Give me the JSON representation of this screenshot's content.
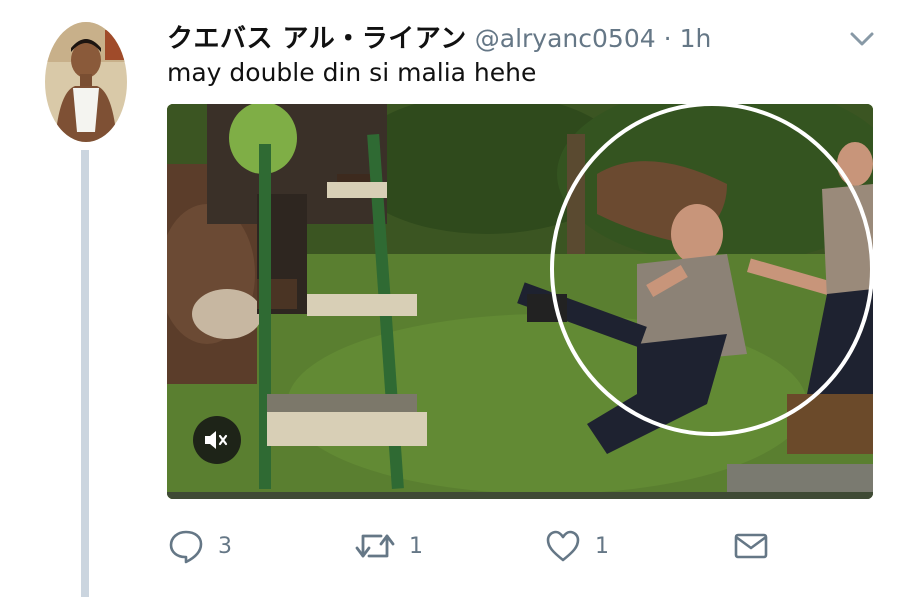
{
  "tweet": {
    "display_name": "クエバス アル・ライアン",
    "handle": "@alryanc0504",
    "separator": "·",
    "time": "1h",
    "text": "may double din si malia hehe"
  },
  "media": {
    "kind": "video",
    "muted": true,
    "progress": 1.0
  },
  "actions": {
    "reply_count": "3",
    "retweet_count": "1",
    "like_count": "1"
  },
  "colors": {
    "secondary_text": "#657786",
    "thread_line": "#cbd5df",
    "icon": "#657786"
  },
  "icons": [
    "chevron-down-icon",
    "reply-icon",
    "retweet-icon",
    "like-icon",
    "direct-message-icon",
    "mute-icon"
  ]
}
